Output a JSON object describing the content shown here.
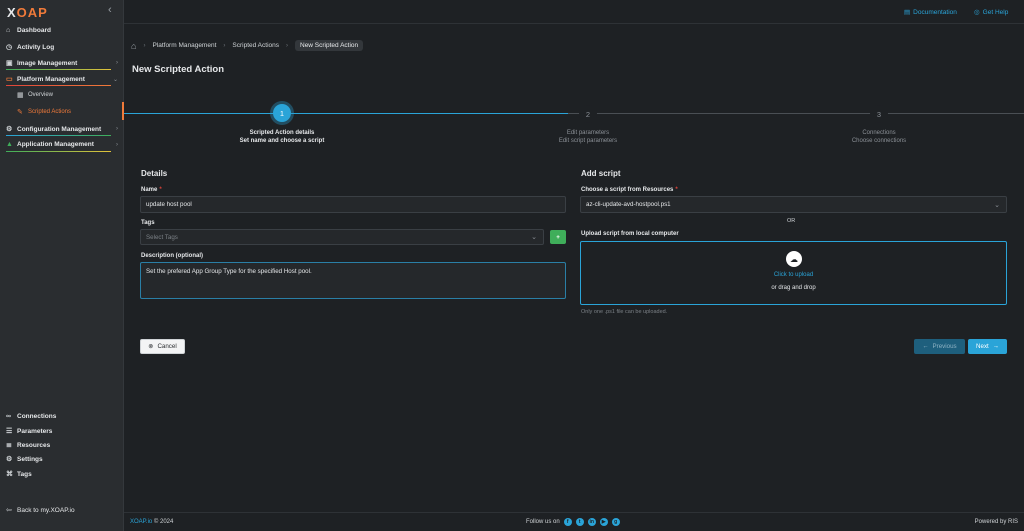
{
  "app": {
    "logo_x": "X",
    "logo_rest": "OAP"
  },
  "sidebar": {
    "items": [
      {
        "label": "Dashboard",
        "icon": "home-icon"
      },
      {
        "label": "Activity Log",
        "icon": "clock-icon"
      },
      {
        "label": "Image Management",
        "icon": "image-icon"
      },
      {
        "label": "Platform Management",
        "icon": "monitor-icon"
      },
      {
        "label": "Overview",
        "icon": "grid-icon"
      },
      {
        "label": "Scripted Actions",
        "icon": "pencil-icon"
      },
      {
        "label": "Configuration Management",
        "icon": "gear-icon"
      },
      {
        "label": "Application Management",
        "icon": "apps-icon"
      }
    ],
    "bottom": [
      {
        "label": "Connections",
        "icon": "link-icon"
      },
      {
        "label": "Parameters",
        "icon": "list-icon"
      },
      {
        "label": "Resources",
        "icon": "stack-icon"
      },
      {
        "label": "Settings",
        "icon": "gear-icon"
      },
      {
        "label": "Tags",
        "icon": "tag-icon"
      }
    ],
    "back": "Back to my.XOAP.io"
  },
  "header": {
    "documentation": "Documentation",
    "help": "Get Help"
  },
  "breadcrumb": {
    "items": [
      "Platform Management",
      "Scripted Actions"
    ],
    "current": "New Scripted Action"
  },
  "page": {
    "title": "New Scripted Action"
  },
  "steps": [
    {
      "num": "1",
      "title": "Scripted Action details",
      "subtitle": "Set name and choose a script"
    },
    {
      "num": "2",
      "title": "Edit parameters",
      "subtitle": "Edit script parameters"
    },
    {
      "num": "3",
      "title": "Connections",
      "subtitle": "Choose connections"
    }
  ],
  "details": {
    "heading": "Details",
    "name_label": "Name",
    "name_value": "update host pool",
    "tags_label": "Tags",
    "tags_placeholder": "Select Tags",
    "add_tag": "+",
    "desc_label": "Description (optional)",
    "desc_value": "Set the prefered App Group Type for the specified Host pool."
  },
  "script": {
    "heading": "Add script",
    "choose_label": "Choose a script from Resources",
    "choose_value": "az-cli-update-avd-hostpool.ps1",
    "or": "OR",
    "upload_label": "Upload script from local computer",
    "click_upload": "Click to upload",
    "drag_drop": "or drag and drop",
    "hint": "Only one .ps1 file can be uploaded."
  },
  "buttons": {
    "cancel": "Cancel",
    "previous": "Previous",
    "next": "Next"
  },
  "footer": {
    "brand": "XOAP.io",
    "copyright": "© 2024",
    "follow": "Follow us on",
    "powered": "Powered by RIS"
  },
  "colors": {
    "accent": "#2aa4d8",
    "brand": "#f07a3a",
    "green": "#3fae5a",
    "background": "#1e2124"
  }
}
